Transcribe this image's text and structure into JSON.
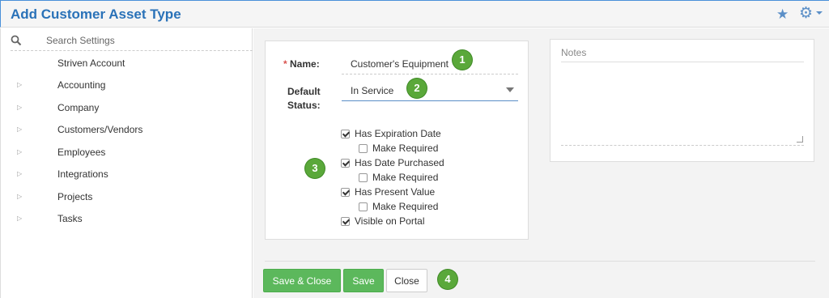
{
  "header": {
    "title": "Add Customer Asset Type",
    "icons": [
      "star-icon",
      "gear-icon",
      "chevron-down-icon"
    ]
  },
  "colors": {
    "accent": "#2a72b8",
    "button_green": "#5cb85c",
    "badge_green": "#5aa83a",
    "required": "#d9534f"
  },
  "sidebar": {
    "search": {
      "placeholder": "Search Settings",
      "value": ""
    },
    "items": [
      {
        "label": "Striven Account",
        "expandable": false
      },
      {
        "label": "Accounting",
        "expandable": true
      },
      {
        "label": "Company",
        "expandable": true
      },
      {
        "label": "Customers/Vendors",
        "expandable": true
      },
      {
        "label": "Employees",
        "expandable": true
      },
      {
        "label": "Integrations",
        "expandable": true
      },
      {
        "label": "Projects",
        "expandable": true
      },
      {
        "label": "Tasks",
        "expandable": true
      }
    ]
  },
  "form": {
    "required_mark": "*",
    "name_label": "Name:",
    "name_value": "Customer's Equipment",
    "status_label_line1": "Default",
    "status_label_line2": "Status:",
    "status_value": "In Service",
    "checkboxes": [
      {
        "label": "Has Expiration Date",
        "checked": true
      },
      {
        "label": "Make Required",
        "checked": false
      },
      {
        "label": "Has Date Purchased",
        "checked": true
      },
      {
        "label": "Make Required",
        "checked": false
      },
      {
        "label": "Has Present Value",
        "checked": true
      },
      {
        "label": "Make Required",
        "checked": false
      },
      {
        "label": "Visible on Portal",
        "checked": true
      }
    ]
  },
  "notes": {
    "label": "Notes",
    "value": ""
  },
  "buttons": {
    "save_close": "Save & Close",
    "save": "Save",
    "close": "Close"
  },
  "badges": [
    "1",
    "2",
    "3",
    "4"
  ]
}
